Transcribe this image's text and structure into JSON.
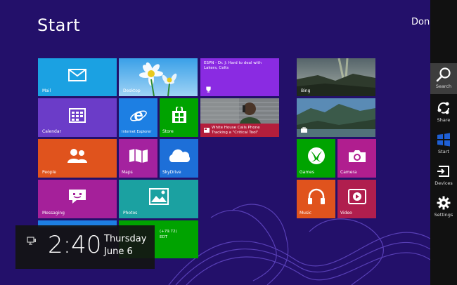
{
  "screen": {
    "title": "Start",
    "user": "Don"
  },
  "tiles": {
    "mail": "Mail",
    "desktop": "Desktop",
    "espn_news": "ESPN - Dr. J: Hard to deal with Lakers, Celts",
    "bing": "Bing",
    "calendar": "Calendar",
    "internet_explorer": "Internet Explorer",
    "store": "Store",
    "news_headline": "White House Calls Phone Tracking a \"Critical Tool\"",
    "people": "People",
    "maps": "Maps",
    "skydrive": "SkyDrive",
    "games": "Games",
    "camera": "Camera",
    "messaging": "Messaging",
    "photos": "Photos",
    "music": "Music",
    "video": "Video",
    "finance_change": "(+79.72)",
    "finance_time": "EDT"
  },
  "clock": {
    "time": "2:40",
    "day": "Thursday",
    "date": "June 6"
  },
  "charms": [
    {
      "label": "Search",
      "icon": "search-icon"
    },
    {
      "label": "Share",
      "icon": "share-icon"
    },
    {
      "label": "Start",
      "icon": "windows-icon"
    },
    {
      "label": "Devices",
      "icon": "devices-icon"
    },
    {
      "label": "Settings",
      "icon": "gear-icon"
    }
  ],
  "colors": {
    "background": "#23106a",
    "charms_bar": "#111111",
    "mail": "#1ba1e2",
    "desktop": "#1ba1e2",
    "espn": "#8a2be2",
    "calendar": "#6b3cc8",
    "internet_explorer": "#1d7fe3",
    "store": "#00a300",
    "people": "#e0531d",
    "maps": "#a4229f",
    "skydrive": "#1d6fd8",
    "games": "#00a300",
    "camera": "#b01e8f",
    "messaging": "#a5209a",
    "photos": "#1ba1a1",
    "music": "#e0531d",
    "video": "#b01e4e",
    "finance": "#00a300"
  }
}
